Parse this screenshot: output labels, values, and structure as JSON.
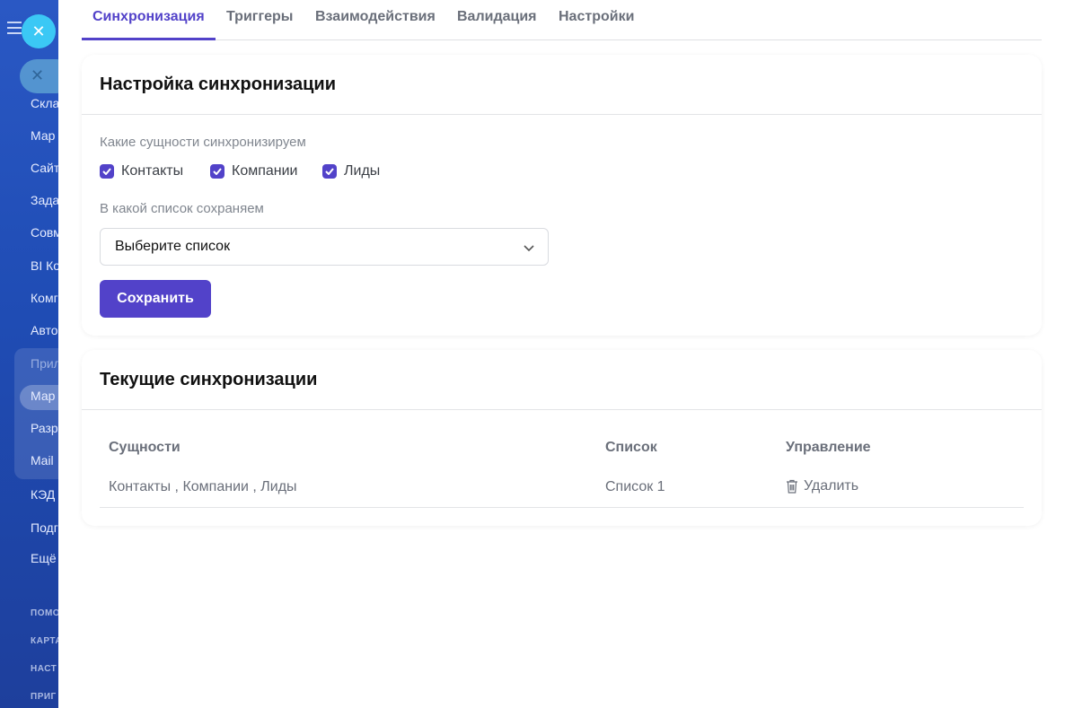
{
  "background_sidebar": {
    "items": [
      "Скла",
      "Мар",
      "Сайт",
      "Зада",
      "Совм",
      "BI Ко",
      "Комг",
      "Авто",
      "Прил",
      "Мар",
      "Разр",
      "Mail",
      "КЭД",
      "Подг",
      "Ещё"
    ],
    "small_items": [
      "ПОМО",
      "КАРТА",
      "НАСТ",
      "ПРИГ"
    ]
  },
  "tabs": [
    "Синхронизация",
    "Триггеры",
    "Взаимодействия",
    "Валидация",
    "Настройки"
  ],
  "settings_card": {
    "title": "Настройка синхронизации",
    "entities_label": "Какие сущности синхронизируем",
    "entities": [
      "Контакты",
      "Компании",
      "Лиды"
    ],
    "list_label": "В какой список сохраняем",
    "list_placeholder": "Выберите список",
    "save_label": "Сохранить"
  },
  "current_card": {
    "title": "Текущие синхронизации",
    "columns": [
      "Сущности",
      "Список",
      "Управление"
    ],
    "rows": [
      {
        "entities": "Контакты , Компании , Лиды",
        "list": "Список 1",
        "action": "Удалить"
      }
    ]
  },
  "colors": {
    "accent": "#5242c9",
    "close_button": "#3bc8f5",
    "sidebar": "#2a58c4"
  }
}
